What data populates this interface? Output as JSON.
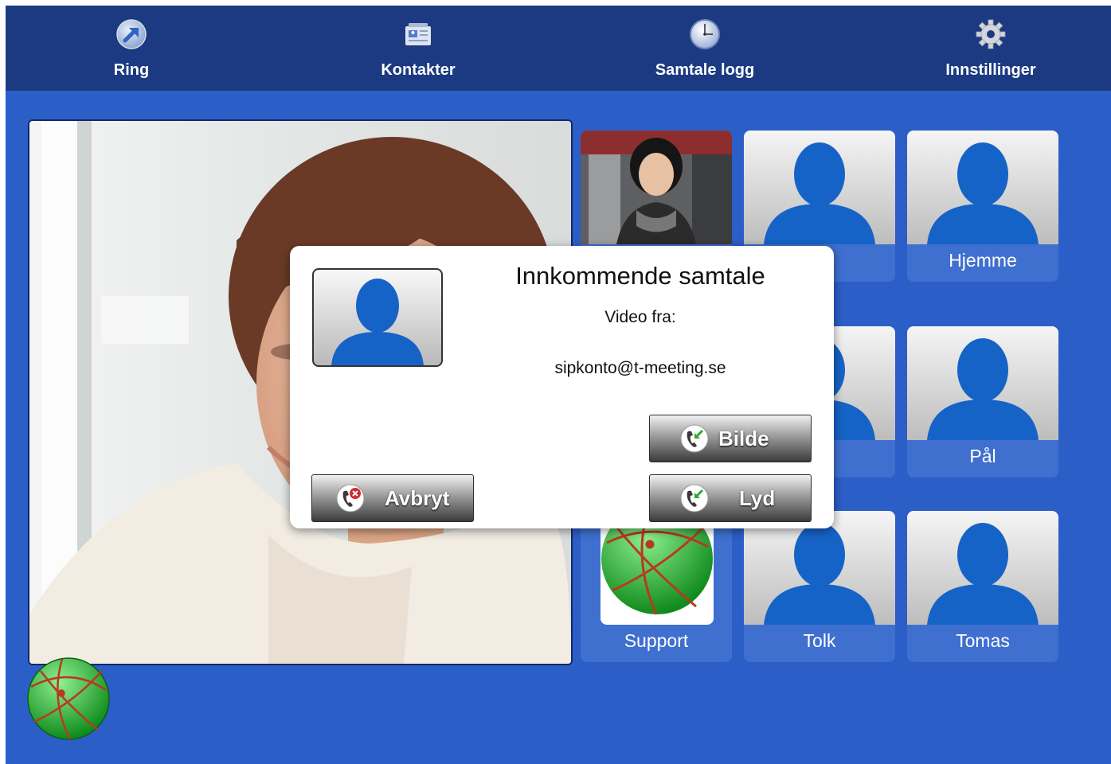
{
  "nav": {
    "ring": "Ring",
    "contacts": "Kontakter",
    "call_log": "Samtale logg",
    "settings": "Innstillinger"
  },
  "contacts": {
    "row1": [
      "",
      "id",
      "Hjemme"
    ],
    "row2": [
      "",
      "s",
      "Pål"
    ],
    "row3": [
      "Support",
      "Tolk",
      "Tomas"
    ]
  },
  "dialog": {
    "title": "Innkommende samtale",
    "subtitle": "Video fra:",
    "address": "sipkonto@t-meeting.se",
    "buttons": {
      "picture": "Bilde",
      "audio": "Lyd",
      "cancel": "Avbryt"
    }
  },
  "colors": {
    "background": "#2c5ec8",
    "topbar": "#1b3a82",
    "tile": "#3f6fcf",
    "avatar_blue": "#1560c4",
    "globe_green": "#2fb23d"
  },
  "icons": {
    "ring": "call-arrow-icon",
    "contacts": "address-card-icon",
    "call_log": "clock-icon",
    "settings": "gear-icon",
    "accept": "phone-accept-icon",
    "decline": "phone-decline-icon",
    "globe": "globe-icon"
  }
}
